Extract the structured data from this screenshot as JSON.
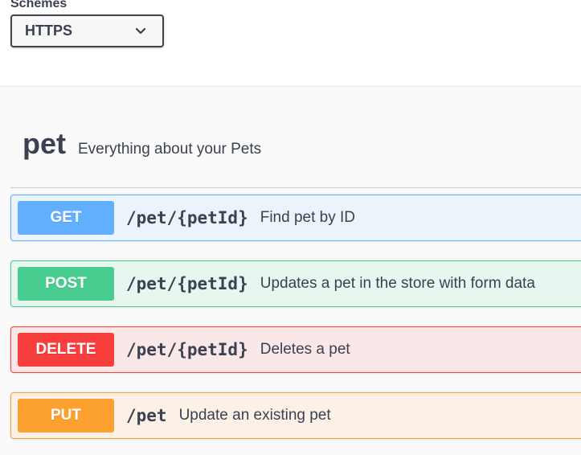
{
  "schemes": {
    "label": "Schemes",
    "selected": "HTTPS"
  },
  "tag": {
    "name": "pet",
    "description": "Everything about your Pets"
  },
  "operations": [
    {
      "method": "GET",
      "path": "/pet/{petId}",
      "summary": "Find pet by ID",
      "color": "#61affe",
      "bg": "#ebf3fb",
      "border": "#61affe"
    },
    {
      "method": "POST",
      "path": "/pet/{petId}",
      "summary": "Updates a pet in the store with form data",
      "color": "#49cc90",
      "bg": "#e8f6f0",
      "border": "#49cc90"
    },
    {
      "method": "DELETE",
      "path": "/pet/{petId}",
      "summary": "Deletes a pet",
      "color": "#f93e3e",
      "bg": "#fae7e7",
      "border": "#f93e3e"
    },
    {
      "method": "PUT",
      "path": "/pet",
      "summary": "Update an existing pet",
      "color": "#fca130",
      "bg": "#fbf1e6",
      "border": "#fca130"
    }
  ]
}
